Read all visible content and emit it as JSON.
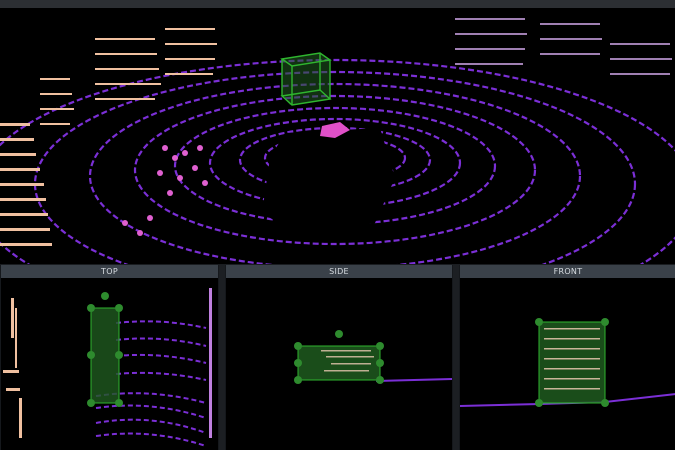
{
  "views": {
    "top": {
      "label": "TOP"
    },
    "side": {
      "label": "SIDE"
    },
    "front": {
      "label": "FRONT"
    }
  },
  "colors": {
    "background": "#000000",
    "panel_header": "#3a4149",
    "cuboid": "#2fb52f",
    "cuboid_fill": "#1f5a1f",
    "handle": "#2e8b2e",
    "point_near": "#8a2be2",
    "point_far": "#ff66cc",
    "point_top": "#f4d6a0"
  },
  "icons": {
    "handle": "resize-handle-icon"
  }
}
